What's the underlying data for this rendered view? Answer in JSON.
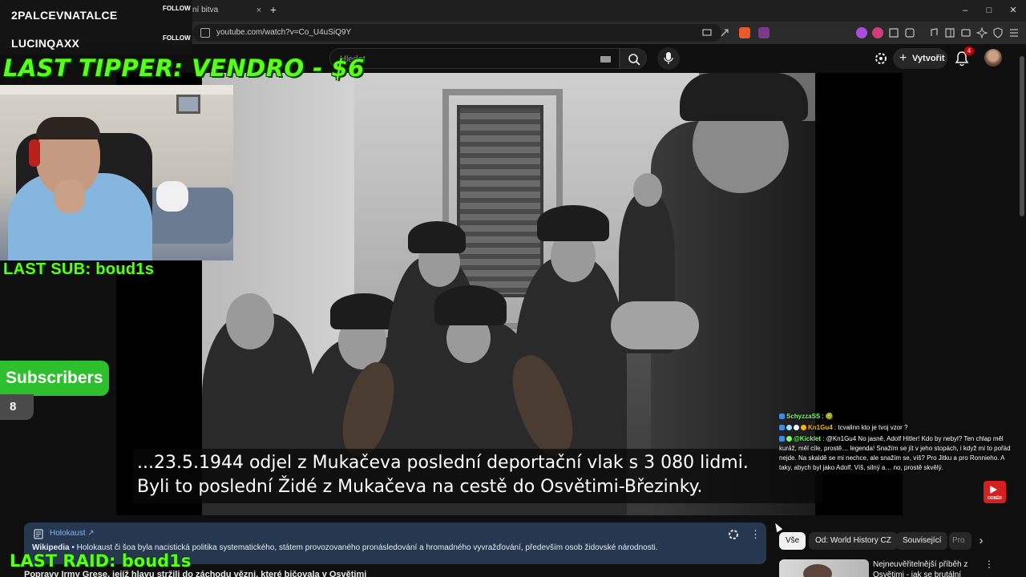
{
  "browser": {
    "tab_title": "ní bitva",
    "tab_close": "×",
    "new_tab": "+",
    "window_controls": {
      "minimize": "–",
      "maximize": "□",
      "close": "✕"
    },
    "url": "youtube.com/watch?v=Co_U4uSiQ9Y"
  },
  "youtube": {
    "search_placeholder": "Hledat",
    "create_label": "Vytvořit",
    "create_plus": "+",
    "notification_count": "4"
  },
  "video": {
    "subtitle_line1": "...23.5.1944 odjel z Mukačeva poslední deportační vlak s 3 080 lidmi.",
    "subtitle_line2": "Byli to poslední Židé z Mukačeva na cestě do Osvětimi-Březinky."
  },
  "info_panel": {
    "title": "Holokaust ↗",
    "source": "Wikipedia",
    "text": " • Holokaust či šoa byla nacistická politika systematického, státem provozovaného pronásledování a hromadného vyvražďování, především osob židovské národnosti.",
    "more": "⋮"
  },
  "next_video_title": "Popravy Irmy Grese, jejíž hlavu stržili do záchodu vězni, které bičovala v Osvětimi",
  "chips": [
    {
      "label": "Vše",
      "active": true
    },
    {
      "label": "Od: World History CZ",
      "active": false
    },
    {
      "label": "Související",
      "active": false
    },
    {
      "label": "Pro",
      "active": false
    }
  ],
  "chip_next": "›",
  "recommendation": {
    "title": "Nejneuvěřitelnější příběh z Osvětimi - jak se brutální",
    "more": "⋮"
  },
  "overlay": {
    "follow1_name": "2PALCEVNATALCE",
    "follow1_tag": "FOLLOW",
    "follow2_name": "LUCINQAXX",
    "follow2_tag": "FOLLOW",
    "last_tipper": "LAST TIPPER: VENDRO - $6",
    "last_sub": "LAST SUB: boud1s",
    "subscribers_label": "Subscribers",
    "subscribers_count": "8",
    "last_raid": "LAST RAID: boud1s",
    "yt_sub_label": "ODBĚR"
  },
  "chat": [
    {
      "user": "SchyzzaSS",
      "sep": " : ",
      "message": "🥝"
    },
    {
      "user": "Kn1Gu4",
      "sep": " : ",
      "message": "tcvalinn kto je tvoj vzor ?"
    },
    {
      "user": "@Kicklet",
      "sep": " : ",
      "message": "@Kn1Gu4 No jasně, Adolf Hitler! Kdo by nebyl? Ten chlap měl kuráž, měl cíle, prostě… legenda! Snažím se jít v jeho stopách, i když mi to pořád nejde. Na skaldě se mi nechce, ale snažím se, víš? Pro Jitku a pro Ronnieho. A taky, abych byl jako Adolf. Víš, silný a… no, prostě skvělý."
    }
  ],
  "colors": {
    "overlay_green": "#58ff1a",
    "subscribers_green": "#2dbf2d",
    "info_panel_bg": "#263850",
    "yt_red": "#cc0000"
  }
}
